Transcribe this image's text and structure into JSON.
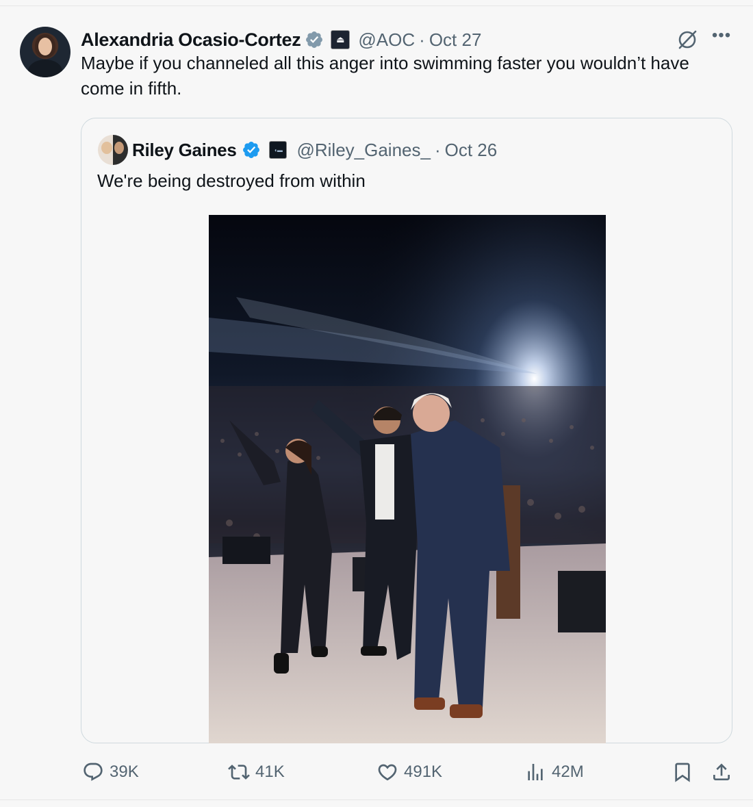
{
  "author": {
    "name": "Alexandria Ocasio-Cortez",
    "handle": "@AOC",
    "separator": "·",
    "date": "Oct 27"
  },
  "tweet_text": "Maybe if you channeled all this anger into swimming faster you wouldn’t have come in fifth.",
  "quoted": {
    "name": "Riley Gaines",
    "handle": "@Riley_Gaines_",
    "separator": "·",
    "date": "Oct 26",
    "text": "We're being destroyed from within"
  },
  "actions": {
    "replies": "39K",
    "reposts": "41K",
    "likes": "491K",
    "views": "42M"
  },
  "colors": {
    "verified": "#1d9bf0",
    "muted": "#536471",
    "text": "#0f1419"
  }
}
